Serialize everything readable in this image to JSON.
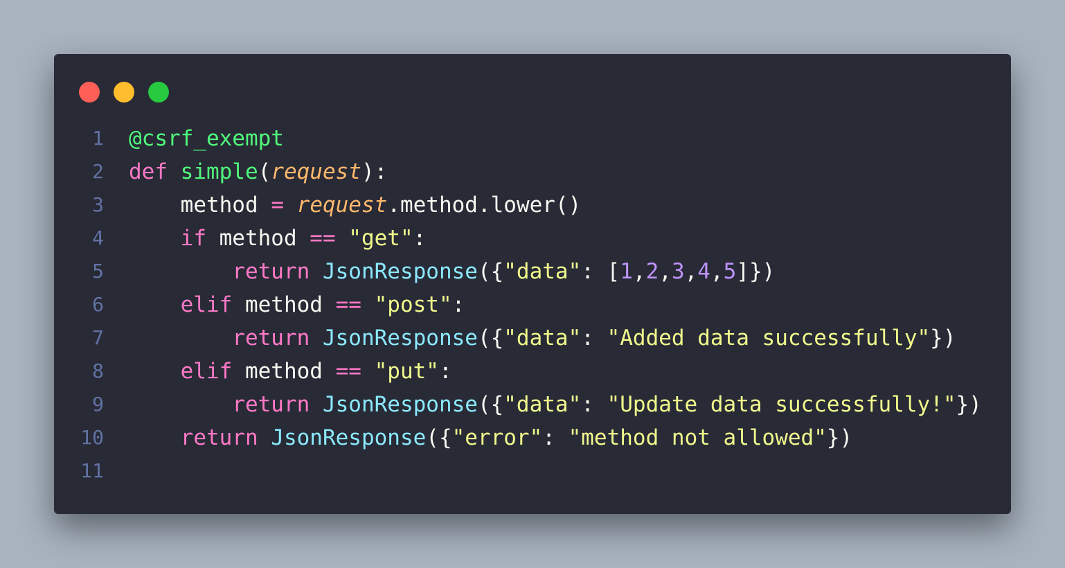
{
  "colors": {
    "page_background": "#a8b3bf",
    "editor_background": "#282a36",
    "gutter": "#6272a4",
    "default": "#f8f8f2",
    "keyword": "#ff79c6",
    "function": "#50fa7b",
    "class": "#8be9fd",
    "string": "#f1fa8c",
    "number": "#bd93f9",
    "param": "#ffb86c"
  },
  "window_controls": [
    {
      "name": "close",
      "color": "#ff5f56"
    },
    {
      "name": "minimize",
      "color": "#ffbd2e"
    },
    {
      "name": "maximize",
      "color": "#27c93f"
    }
  ],
  "code_lines": [
    {
      "number": "1",
      "tokens": [
        {
          "text": "@csrf_exempt",
          "kind": "function"
        }
      ]
    },
    {
      "number": "2",
      "tokens": [
        {
          "text": "def ",
          "kind": "keyword"
        },
        {
          "text": "simple",
          "kind": "function"
        },
        {
          "text": "(",
          "kind": "default"
        },
        {
          "text": "request",
          "kind": "param",
          "italic": true
        },
        {
          "text": "):",
          "kind": "default"
        }
      ]
    },
    {
      "number": "3",
      "tokens": [
        {
          "text": "    method ",
          "kind": "default"
        },
        {
          "text": "=",
          "kind": "keyword"
        },
        {
          "text": " ",
          "kind": "default"
        },
        {
          "text": "request",
          "kind": "param",
          "italic": true
        },
        {
          "text": ".method.lower()",
          "kind": "default"
        }
      ]
    },
    {
      "number": "4",
      "tokens": [
        {
          "text": "    ",
          "kind": "default"
        },
        {
          "text": "if",
          "kind": "keyword"
        },
        {
          "text": " method ",
          "kind": "default"
        },
        {
          "text": "==",
          "kind": "keyword"
        },
        {
          "text": " ",
          "kind": "default"
        },
        {
          "text": "\"get\"",
          "kind": "string"
        },
        {
          "text": ":",
          "kind": "default"
        }
      ]
    },
    {
      "number": "5",
      "tokens": [
        {
          "text": "        ",
          "kind": "default"
        },
        {
          "text": "return",
          "kind": "keyword"
        },
        {
          "text": " ",
          "kind": "default"
        },
        {
          "text": "JsonResponse",
          "kind": "class"
        },
        {
          "text": "({",
          "kind": "default"
        },
        {
          "text": "\"data\"",
          "kind": "string"
        },
        {
          "text": ": [",
          "kind": "default"
        },
        {
          "text": "1",
          "kind": "number"
        },
        {
          "text": ",",
          "kind": "default"
        },
        {
          "text": "2",
          "kind": "number"
        },
        {
          "text": ",",
          "kind": "default"
        },
        {
          "text": "3",
          "kind": "number"
        },
        {
          "text": ",",
          "kind": "default"
        },
        {
          "text": "4",
          "kind": "number"
        },
        {
          "text": ",",
          "kind": "default"
        },
        {
          "text": "5",
          "kind": "number"
        },
        {
          "text": "]})",
          "kind": "default"
        }
      ]
    },
    {
      "number": "6",
      "tokens": [
        {
          "text": "    ",
          "kind": "default"
        },
        {
          "text": "elif",
          "kind": "keyword"
        },
        {
          "text": " method ",
          "kind": "default"
        },
        {
          "text": "==",
          "kind": "keyword"
        },
        {
          "text": " ",
          "kind": "default"
        },
        {
          "text": "\"post\"",
          "kind": "string"
        },
        {
          "text": ":",
          "kind": "default"
        }
      ]
    },
    {
      "number": "7",
      "tokens": [
        {
          "text": "        ",
          "kind": "default"
        },
        {
          "text": "return",
          "kind": "keyword"
        },
        {
          "text": " ",
          "kind": "default"
        },
        {
          "text": "JsonResponse",
          "kind": "class"
        },
        {
          "text": "({",
          "kind": "default"
        },
        {
          "text": "\"data\"",
          "kind": "string"
        },
        {
          "text": ": ",
          "kind": "default"
        },
        {
          "text": "\"Added data successfully\"",
          "kind": "string"
        },
        {
          "text": "})",
          "kind": "default"
        }
      ]
    },
    {
      "number": "8",
      "tokens": [
        {
          "text": "    ",
          "kind": "default"
        },
        {
          "text": "elif",
          "kind": "keyword"
        },
        {
          "text": " method ",
          "kind": "default"
        },
        {
          "text": "==",
          "kind": "keyword"
        },
        {
          "text": " ",
          "kind": "default"
        },
        {
          "text": "\"put\"",
          "kind": "string"
        },
        {
          "text": ":",
          "kind": "default"
        }
      ]
    },
    {
      "number": "9",
      "tokens": [
        {
          "text": "        ",
          "kind": "default"
        },
        {
          "text": "return",
          "kind": "keyword"
        },
        {
          "text": " ",
          "kind": "default"
        },
        {
          "text": "JsonResponse",
          "kind": "class"
        },
        {
          "text": "({",
          "kind": "default"
        },
        {
          "text": "\"data\"",
          "kind": "string"
        },
        {
          "text": ": ",
          "kind": "default"
        },
        {
          "text": "\"Update data successfully!\"",
          "kind": "string"
        },
        {
          "text": "})",
          "kind": "default"
        }
      ]
    },
    {
      "number": "10",
      "tokens": [
        {
          "text": "    ",
          "kind": "default"
        },
        {
          "text": "return",
          "kind": "keyword"
        },
        {
          "text": " ",
          "kind": "default"
        },
        {
          "text": "JsonResponse",
          "kind": "class"
        },
        {
          "text": "({",
          "kind": "default"
        },
        {
          "text": "\"error\"",
          "kind": "string"
        },
        {
          "text": ": ",
          "kind": "default"
        },
        {
          "text": "\"method not allowed\"",
          "kind": "string"
        },
        {
          "text": "})",
          "kind": "default"
        }
      ]
    },
    {
      "number": "11",
      "tokens": []
    }
  ]
}
